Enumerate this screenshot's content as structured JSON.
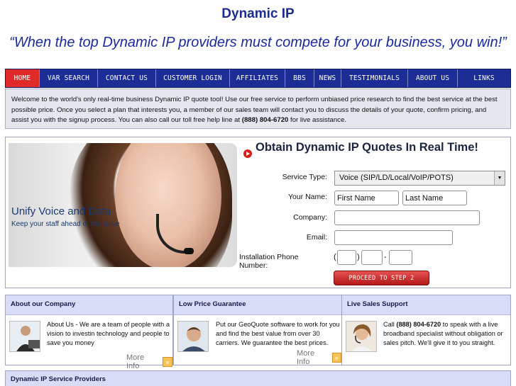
{
  "header": {
    "title": "Dynamic IP",
    "tagline": "“When the top Dynamic IP providers must compete for your business, you win!”"
  },
  "nav": {
    "items": [
      {
        "label": "HOME"
      },
      {
        "label": "VAR SEARCH"
      },
      {
        "label": "CONTACT US"
      },
      {
        "label": "CUSTOMER LOGIN"
      },
      {
        "label": "AFFILIATES"
      },
      {
        "label": "BBS"
      },
      {
        "label": "NEWS"
      },
      {
        "label": "TESTIMONIALS"
      },
      {
        "label": "ABOUT US"
      },
      {
        "label": "LINKS"
      }
    ],
    "active_color": "#e02a2a",
    "bar_color": "#1c2d96"
  },
  "welcome": {
    "text_before": "Welcome to the world's only real-time business Dynamic IP quote tool! Use our free service to perform unbiased price research to find the best service at the best possible price. Once you select a plan that interests you, a member of our sales team will contact you to discuss the details of your quote, confirm pricing, and assist you with the signup process. You can also call our toll free help line at ",
    "phone": "(888) 804-6720",
    "text_after": " for live assistance."
  },
  "hero": {
    "title": "Unify Voice and Data",
    "subtitle": "Keep your staff ahead of the curve"
  },
  "quote_form": {
    "heading": "Obtain Dynamic IP Quotes In Real Time!",
    "service_type_label": "Service Type:",
    "service_type_value": "Voice (SIP/LD/Local/VoIP/POTS)",
    "name_label": "Your Name:",
    "first_name_value": "First Name",
    "last_name_value": "Last Name",
    "company_label": "Company:",
    "email_label": "Email:",
    "phone_label": "Installation Phone Number:",
    "phone_open": "(",
    "phone_close": ")",
    "phone_dash": "-",
    "submit_label": "PROCEED TO STEP 2"
  },
  "columns": [
    {
      "heading": "About our Company",
      "text": "About Us - We are a team of people with a vision to investin technology and people to save you money",
      "more_label": "More Info",
      "icon": "person-at-computer-icon"
    },
    {
      "heading": "Low Price Guarantee",
      "text": "Put our GeoQuote software to work for you and find the best value from over 30 carriers. We guarantee the best prices.",
      "more_label": "More Info",
      "icon": "man-portrait-icon"
    },
    {
      "heading": "Live Sales Support",
      "text_before": "Call ",
      "phone": "(888) 804-6720",
      "text_after": " to speak with a live broadband specialist without obligation or sales pitch. We'll give it to you straight.",
      "icon": "support-agent-icon"
    }
  ],
  "providers": {
    "heading": "Dynamic IP Service Providers"
  },
  "more_icon_glyph": "»"
}
